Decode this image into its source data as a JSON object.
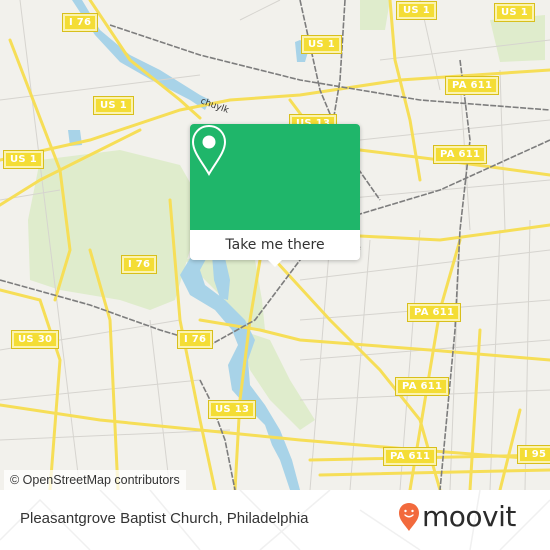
{
  "map": {
    "road_shields": [
      {
        "id": "us1-top-center",
        "label": "US 1"
      },
      {
        "id": "us1-top-right",
        "label": "US 1"
      },
      {
        "id": "i76-top",
        "label": "I 76"
      },
      {
        "id": "us1-upper-mid",
        "label": "US 1"
      },
      {
        "id": "us1-left",
        "label": "US 1"
      },
      {
        "id": "us1-upper-right",
        "label": "US 1"
      },
      {
        "id": "pa611-1",
        "label": "PA 611"
      },
      {
        "id": "us13-top",
        "label": "US 13"
      },
      {
        "id": "pa611-2",
        "label": "PA 611"
      },
      {
        "id": "i76-mid",
        "label": "I 76"
      },
      {
        "id": "i76-lower",
        "label": "I 76"
      },
      {
        "id": "us30",
        "label": "US 30"
      },
      {
        "id": "pa611-3",
        "label": "PA 611"
      },
      {
        "id": "pa611-4",
        "label": "PA 611"
      },
      {
        "id": "us13-bottom",
        "label": "US 13"
      },
      {
        "id": "pa611-5",
        "label": "PA 611"
      },
      {
        "id": "i95",
        "label": "I 95"
      }
    ],
    "river_label": "chuylk",
    "attribution": "© OpenStreetMap contributors"
  },
  "popup": {
    "icon": "location-pin-icon",
    "accent_color": "#1fb66a",
    "action_label": "Take me there"
  },
  "footer": {
    "place_name": "Pleasantgrove Baptist Church, Philadelphia",
    "brand": "moovit",
    "brand_color": "#f26a3d"
  }
}
